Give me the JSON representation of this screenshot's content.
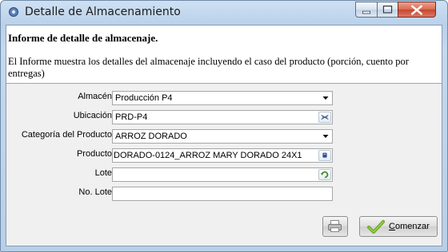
{
  "window": {
    "title": "Detalle de Almacenamiento",
    "app_icon": "gear-icon",
    "controls": [
      "minimize-icon",
      "maximize-icon",
      "close-icon"
    ]
  },
  "header": {
    "title": "Informe de detalle de almacenaje.",
    "description": "El Informe muestra los detalles del almacenaje incluyendo el caso del producto (porción, cuento por entregas)"
  },
  "form": {
    "fields": [
      {
        "label": "Almacén",
        "value": "Producción P4",
        "control": "dropdown"
      },
      {
        "label": "Ubicación",
        "value": "PRD-P4",
        "control": "locator-button"
      },
      {
        "label": "Categoría del Producto",
        "value": "ARROZ DORADO",
        "control": "dropdown"
      },
      {
        "label": "Producto",
        "value": "DORADO-0124_ARROZ MARY DORADO 24X1",
        "control": "info-button"
      },
      {
        "label": "Lote",
        "value": "",
        "control": "refresh-button"
      },
      {
        "label": "No. Lote",
        "value": "",
        "control": "none"
      }
    ]
  },
  "footer": {
    "print_icon": "printer-icon",
    "start_mnemonic": "C",
    "start_rest": "omenzar",
    "start_icon": "checkmark-icon"
  },
  "colors": {
    "titlebar": "#c4d8ee",
    "close_button": "#c7462b",
    "form_background": "#f0f0f0",
    "checkmark": "#6aa521"
  }
}
